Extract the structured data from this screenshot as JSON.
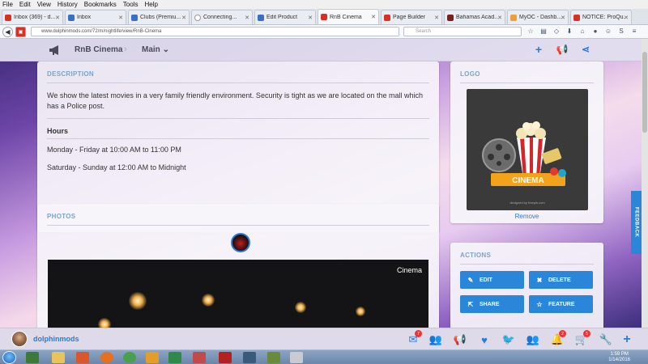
{
  "browser": {
    "menu": [
      "File",
      "Edit",
      "View",
      "History",
      "Bookmarks",
      "Tools",
      "Help"
    ],
    "tabs": [
      {
        "label": "Inbox (369) - d...",
        "color": "#d93025"
      },
      {
        "label": "Inbox",
        "color": "#3b6fc4"
      },
      {
        "label": "Clubs (Premiu...",
        "color": "#3b6fc4"
      },
      {
        "label": "Connecting...",
        "color": "#999999"
      },
      {
        "label": "Edit Product",
        "color": "#3b6fc4"
      },
      {
        "label": "RnB Cinema",
        "color": "#d93025",
        "active": true
      },
      {
        "label": "Page Builder",
        "color": "#d93025"
      },
      {
        "label": "Bahamas Acad...",
        "color": "#7a1f1f"
      },
      {
        "label": "MyOC - Dashb...",
        "color": "#e8a23a"
      },
      {
        "label": "NOTICE: ProQu...",
        "color": "#d93025"
      }
    ],
    "url": "www.dolphinmods.com/72/m/nightlife/view/RnB-Cinema",
    "search_placeholder": "Search"
  },
  "header": {
    "title": "RnB Cinema",
    "section": "Main"
  },
  "description": {
    "title": "DESCRIPTION",
    "text": "We show the latest movies in a very family friendly environment. Security is tight as we are located on the mall which has a Police post.",
    "hours_label": "Hours",
    "hours": [
      "Monday - Friday at 10:00 AM to 11:00 PM",
      "Saturday - Sunday at 12:00 AM to Midnight"
    ]
  },
  "photos": {
    "title": "PHOTOS",
    "caption": "Cinema"
  },
  "logo": {
    "title": "LOGO",
    "remove_label": "Remove",
    "logo_text": "CINEMA",
    "credit": "designed by freepik.com"
  },
  "actions": {
    "title": "ACTIONS",
    "buttons": [
      {
        "label": "EDIT",
        "icon": "pencil-icon"
      },
      {
        "label": "DELETE",
        "icon": "x-icon"
      },
      {
        "label": "SHARE",
        "icon": "share-icon"
      },
      {
        "label": "FEATURE",
        "icon": "star-icon"
      }
    ]
  },
  "feedback_label": "FEEDBACK",
  "bottombar": {
    "username": "dolphinmods",
    "mail_badge": "7",
    "notifications_badge": "2",
    "cart_badge": "5"
  },
  "taskbar": {
    "time": "1:59 PM",
    "date": "1/14/2016"
  },
  "accent": "#2a86d8"
}
